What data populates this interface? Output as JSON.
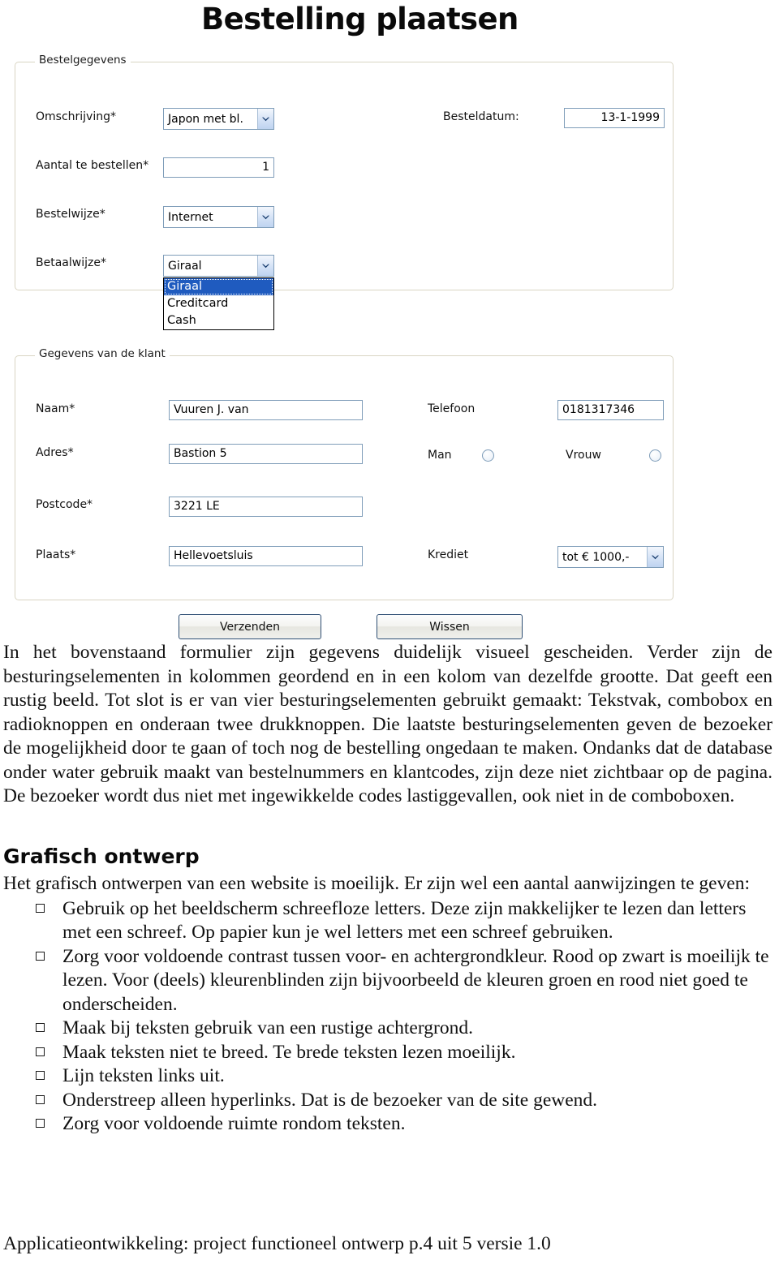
{
  "form": {
    "title": "Bestelling plaatsen",
    "order_group": {
      "legend": "Bestelgegevens",
      "fields": {
        "omschrijving_label": "Omschrijving*",
        "omschrijving_value": "Japon met bl.",
        "aantal_label": "Aantal te bestellen*",
        "aantal_value": "1",
        "bestelwijze_label": "Bestelwijze*",
        "bestelwijze_value": "Internet",
        "betaalwijze_label": "Betaalwijze*",
        "betaalwijze_value": "Giraal",
        "besteldatum_label": "Besteldatum:",
        "besteldatum_value": "13-1-1999"
      },
      "betaalwijze_options": [
        "Giraal",
        "Creditcard",
        "Cash"
      ],
      "betaalwijze_selected_index": 0
    },
    "customer_group": {
      "legend": "Gegevens van de klant",
      "fields": {
        "naam_label": "Naam*",
        "naam_value": "Vuuren J. van",
        "adres_label": "Adres*",
        "adres_value": "Bastion 5",
        "postcode_label": "Postcode*",
        "postcode_value": "3221 LE",
        "plaats_label": "Plaats*",
        "plaats_value": "Hellevoetsluis",
        "telefoon_label": "Telefoon",
        "telefoon_value": "0181317346",
        "man_label": "Man",
        "vrouw_label": "Vrouw",
        "krediet_label": "Krediet",
        "krediet_value": "tot € 1000,-"
      }
    },
    "buttons": {
      "submit_label": "Verzenden",
      "clear_label": "Wissen"
    },
    "colors": {
      "input_border": "#7f9db9",
      "groupbox_border": "#d9d5c3",
      "dropdown_highlight": "#1f5bbf",
      "combo_arrow": "#bed3f0"
    }
  },
  "document": {
    "paragraph_1": "In het bovenstaand formulier zijn gegevens duidelijk visueel gescheiden. Verder zijn de besturingselementen in kolommen geordend en in een kolom van dezelfde grootte. Dat geeft een rustig beeld. Tot slot is er van vier besturingselementen gebruikt gemaakt: Tekstvak, combobox en radioknoppen en onderaan twee drukknoppen. Die laatste besturingselementen geven de bezoeker de mogelijkheid door te gaan of toch nog de bestelling ongedaan te maken. Ondanks dat de database onder water gebruik maakt van bestelnummers en klantcodes, zijn deze niet zichtbaar op de pagina. De bezoeker wordt dus niet met ingewikkelde codes lastiggevallen, ook niet in de comboboxen.",
    "heading_2": "Grafisch ontwerp",
    "paragraph_2": "Het grafisch ontwerpen van een website is moeilijk. Er zijn wel een aantal aanwijzingen te geven:",
    "bullets": [
      "Gebruik op het beeldscherm schreefloze letters. Deze zijn makkelijker te lezen dan letters met een schreef. Op papier kun je wel letters met een schreef gebruiken.",
      "Zorg voor voldoende contrast tussen voor- en achtergrondkleur. Rood op zwart is moeilijk te lezen. Voor (deels) kleurenblinden zijn bijvoorbeeld de kleuren groen en rood niet goed te onderscheiden.",
      "Maak bij teksten gebruik van een rustige achtergrond.",
      "Maak teksten niet te breed. Te brede teksten lezen moeilijk.",
      "Lijn teksten links uit.",
      "Onderstreep alleen hyperlinks. Dat is de bezoeker van de site gewend.",
      "Zorg voor voldoende ruimte rondom teksten."
    ],
    "footer": "Applicatieontwikkeling: project functioneel ontwerp p.4 uit 5 versie 1.0"
  }
}
